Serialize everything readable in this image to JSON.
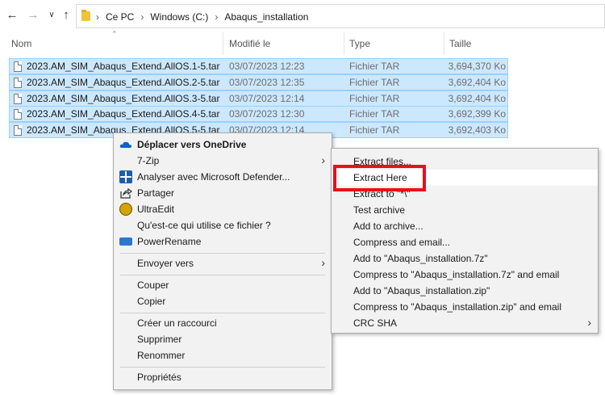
{
  "nav": {
    "back_icon": "arrow-left-icon",
    "forward_icon": "arrow-right-icon",
    "recent_icon": "chevron-down-icon",
    "up_icon": "arrow-up-icon"
  },
  "breadcrumb": [
    "Ce PC",
    "Windows (C:)",
    "Abaqus_installation"
  ],
  "columns": {
    "name": "Nom",
    "modified": "Modifié le",
    "type": "Type",
    "size": "Taille"
  },
  "files": [
    {
      "name": "2023.AM_SIM_Abaqus_Extend.AllOS.1-5.tar",
      "date": "03/07/2023 12:23",
      "type": "Fichier TAR",
      "size": "3,694,370 Ko"
    },
    {
      "name": "2023.AM_SIM_Abaqus_Extend.AllOS.2-5.tar",
      "date": "03/07/2023 12:35",
      "type": "Fichier TAR",
      "size": "3,692,404 Ko"
    },
    {
      "name": "2023.AM_SIM_Abaqus_Extend.AllOS.3-5.tar",
      "date": "03/07/2023 12:14",
      "type": "Fichier TAR",
      "size": "3,692,404 Ko"
    },
    {
      "name": "2023.AM_SIM_Abaqus_Extend.AllOS.4-5.tar",
      "date": "03/07/2023 12:30",
      "type": "Fichier TAR",
      "size": "3,692,399 Ko"
    },
    {
      "name": "2023.AM_SIM_Abaqus_Extend.AllOS.5-5.tar",
      "date": "03/07/2023 12:14",
      "type": "Fichier TAR",
      "size": "3,692,403 Ko"
    }
  ],
  "context_menu": {
    "onedrive": "Déplacer vers OneDrive",
    "sevenzip": "7-Zip",
    "defender": "Analyser avec Microsoft Defender...",
    "share": "Partager",
    "ultraedit": "UltraEdit",
    "whouses": "Qu'est-ce qui utilise ce fichier ?",
    "powerrename": "PowerRename",
    "sendto": "Envoyer vers",
    "cut": "Couper",
    "copy": "Copier",
    "shortcut": "Créer un raccourci",
    "delete": "Supprimer",
    "rename": "Renommer",
    "properties": "Propriétés"
  },
  "submenu": {
    "extract_files": "Extract files...",
    "extract_here": "Extract Here",
    "extract_to": "Extract to \"*\\\"",
    "test": "Test archive",
    "add": "Add to archive...",
    "compress_email": "Compress and email...",
    "add_7z": "Add to \"Abaqus_installation.7z\"",
    "compress_7z_email": "Compress to \"Abaqus_installation.7z\" and email",
    "add_zip": "Add to \"Abaqus_installation.zip\"",
    "compress_zip_email": "Compress to \"Abaqus_installation.zip\" and email",
    "crc": "CRC SHA"
  },
  "colors": {
    "selection": "#cce8ff",
    "selection_border": "#99d1ff",
    "highlight": "#e8101b"
  }
}
